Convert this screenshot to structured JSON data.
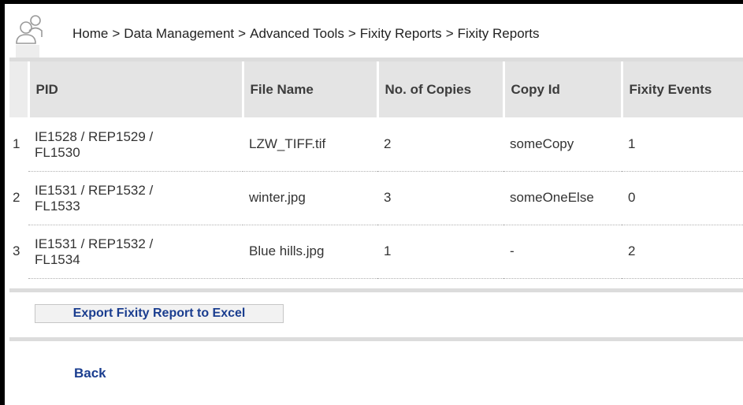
{
  "breadcrumb": {
    "items": [
      "Home",
      "Data Management",
      "Advanced Tools",
      "Fixity Reports",
      "Fixity Reports"
    ],
    "separator": ">"
  },
  "table": {
    "headers": {
      "index": "",
      "pid": "PID",
      "file_name": "File Name",
      "copies": "No. of Copies",
      "copy_id": "Copy Id",
      "fixity_events": "Fixity Events"
    },
    "rows": [
      {
        "index": "1",
        "pid_line1": "IE1528 / REP1529 /",
        "pid_line2": "FL1530",
        "file_name": "LZW_TIFF.tif",
        "copies": "2",
        "copy_id": "someCopy",
        "fixity_events": "1"
      },
      {
        "index": "2",
        "pid_line1": "IE1531 / REP1532 /",
        "pid_line2": "FL1533",
        "file_name": "winter.jpg",
        "copies": "3",
        "copy_id": "someOneElse",
        "fixity_events": "0"
      },
      {
        "index": "3",
        "pid_line1": "IE1531 / REP1532 /",
        "pid_line2": "FL1534",
        "file_name": "Blue hills.jpg",
        "copies": "1",
        "copy_id": "-",
        "fixity_events": "2"
      }
    ]
  },
  "actions": {
    "export_label": "Export Fixity Report to Excel",
    "back_label": "Back"
  },
  "icons": {
    "header_icon": "users-icon"
  },
  "colors": {
    "link": "#1a3d8f",
    "header_bg": "#e4e4e4",
    "rule": "#dcdcdc"
  }
}
